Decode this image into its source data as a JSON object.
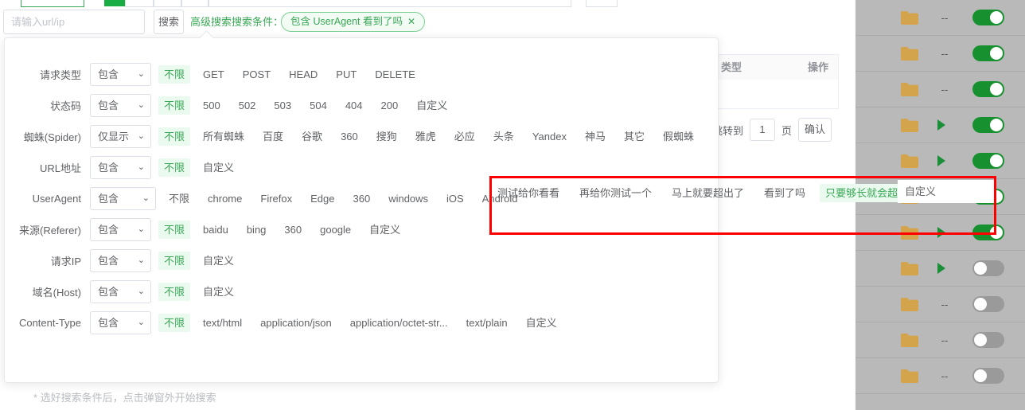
{
  "searchbar": {
    "url_placeholder": "请输入url/ip",
    "search_button": "搜索",
    "advanced_label": "高级搜索搜索条件：",
    "condition_tag": "包含 UserAgent 看到了吗",
    "condition_tag_close": "✕"
  },
  "background_table": {
    "header_type": "类型",
    "header_action": "操作",
    "pager_prefix": "跳转到",
    "pager_value": "1",
    "pager_unit": "页",
    "pager_confirm": "确认"
  },
  "popup": {
    "footnote": "* 选好搜索条件后，点击弹窗外开始搜索",
    "rows": [
      {
        "label": "请求类型",
        "select": "包含",
        "caret": "⌄",
        "options": [
          {
            "text": "不限",
            "state": "selected"
          },
          {
            "text": "GET",
            "state": "normal"
          },
          {
            "text": "POST",
            "state": "normal"
          },
          {
            "text": "HEAD",
            "state": "normal"
          },
          {
            "text": "PUT",
            "state": "normal"
          },
          {
            "text": "DELETE",
            "state": "normal"
          }
        ]
      },
      {
        "label": "状态码",
        "select": "包含",
        "caret": "⌄",
        "options": [
          {
            "text": "不限",
            "state": "selected"
          },
          {
            "text": "500",
            "state": "normal"
          },
          {
            "text": "502",
            "state": "normal"
          },
          {
            "text": "503",
            "state": "normal"
          },
          {
            "text": "504",
            "state": "normal"
          },
          {
            "text": "404",
            "state": "normal"
          },
          {
            "text": "200",
            "state": "normal"
          },
          {
            "text": "自定义",
            "state": "normal"
          }
        ]
      },
      {
        "label": "蜘蛛(Spider)",
        "select": "仅显示",
        "caret": "⌄",
        "options": [
          {
            "text": "不限",
            "state": "selected"
          },
          {
            "text": "所有蜘蛛",
            "state": "normal"
          },
          {
            "text": "百度",
            "state": "normal"
          },
          {
            "text": "谷歌",
            "state": "normal"
          },
          {
            "text": "360",
            "state": "normal"
          },
          {
            "text": "搜狗",
            "state": "normal"
          },
          {
            "text": "雅虎",
            "state": "normal"
          },
          {
            "text": "必应",
            "state": "normal"
          },
          {
            "text": "头条",
            "state": "normal"
          },
          {
            "text": "Yandex",
            "state": "normal"
          },
          {
            "text": "神马",
            "state": "normal"
          },
          {
            "text": "其它",
            "state": "normal"
          },
          {
            "text": "假蜘蛛",
            "state": "normal"
          }
        ]
      },
      {
        "label": "URL地址",
        "select": "包含",
        "caret": "⌄",
        "options": [
          {
            "text": "不限",
            "state": "selected"
          },
          {
            "text": "自定义",
            "state": "normal"
          }
        ]
      },
      {
        "label": "UserAgent",
        "select": "包含",
        "caret": "⌄",
        "options": [
          {
            "text": "不限",
            "state": "normal"
          },
          {
            "text": "chrome",
            "state": "normal"
          },
          {
            "text": "Firefox",
            "state": "normal"
          },
          {
            "text": "Edge",
            "state": "normal"
          },
          {
            "text": "360",
            "state": "normal"
          },
          {
            "text": "windows",
            "state": "normal"
          },
          {
            "text": "iOS",
            "state": "normal"
          },
          {
            "text": "Android",
            "state": "normal"
          }
        ]
      },
      {
        "label": "来源(Referer)",
        "select": "包含",
        "caret": "⌄",
        "options": [
          {
            "text": "不限",
            "state": "selected"
          },
          {
            "text": "baidu",
            "state": "normal"
          },
          {
            "text": "bing",
            "state": "normal"
          },
          {
            "text": "360",
            "state": "normal"
          },
          {
            "text": "google",
            "state": "normal"
          },
          {
            "text": "自定义",
            "state": "normal"
          }
        ]
      },
      {
        "label": "请求IP",
        "select": "包含",
        "caret": "⌄",
        "options": [
          {
            "text": "不限",
            "state": "selected"
          },
          {
            "text": "自定义",
            "state": "normal"
          }
        ]
      },
      {
        "label": "域名(Host)",
        "select": "包含",
        "caret": "⌄",
        "options": [
          {
            "text": "不限",
            "state": "selected"
          },
          {
            "text": "自定义",
            "state": "normal"
          }
        ]
      },
      {
        "label": "Content-Type",
        "select": "包含",
        "caret": "⌄",
        "options": [
          {
            "text": "不限",
            "state": "selected"
          },
          {
            "text": "text/html",
            "state": "normal"
          },
          {
            "text": "application/json",
            "state": "normal"
          },
          {
            "text": "application/octet-str...",
            "state": "normal"
          },
          {
            "text": "text/plain",
            "state": "normal"
          },
          {
            "text": "自定义",
            "state": "normal"
          }
        ]
      }
    ]
  },
  "useragent_overflow": {
    "options": [
      {
        "text": "测试给你看看",
        "state": "normal"
      },
      {
        "text": "再给你测试一个",
        "state": "normal"
      },
      {
        "text": "马上就要超出了",
        "state": "normal"
      },
      {
        "text": "看到了吗",
        "state": "normal"
      },
      {
        "text": "只要够长就会超出来",
        "state": "selected"
      }
    ],
    "custom_label": "自定义"
  },
  "right_list": {
    "rows": [
      {
        "mark": "--",
        "toggle": "on"
      },
      {
        "mark": "--",
        "toggle": "on"
      },
      {
        "mark": "--",
        "toggle": "on"
      },
      {
        "mark": "play",
        "toggle": "on"
      },
      {
        "mark": "play",
        "toggle": "on"
      },
      {
        "mark": "play",
        "toggle": "on"
      },
      {
        "mark": "play",
        "toggle": "on"
      },
      {
        "mark": "play",
        "toggle": "off"
      },
      {
        "mark": "--",
        "toggle": "off"
      },
      {
        "mark": "--",
        "toggle": "off"
      },
      {
        "mark": "--",
        "toggle": "off"
      }
    ]
  },
  "colors": {
    "brand_green": "#3aa856",
    "selected_bg": "#eafaef",
    "toggle_on": "#17912f",
    "toggle_off": "#9a9a9a",
    "annotation_red": "#fe0000",
    "folder_yellow": "#d4a44c"
  }
}
